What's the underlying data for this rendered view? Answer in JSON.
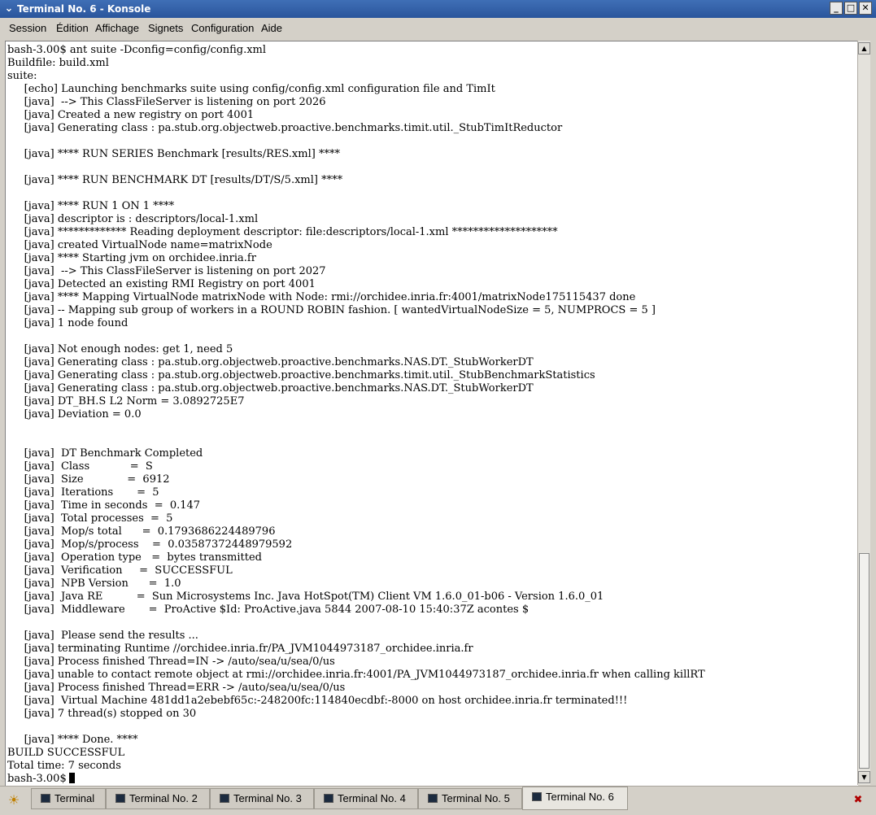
{
  "window": {
    "title": "Terminal No. 6 - Konsole",
    "menu_glyph": "⌄",
    "minimize_glyph": "_",
    "maximize_glyph": "□",
    "close_glyph": "✕"
  },
  "menu": [
    "Session",
    "Édition",
    "Affichage",
    "Signets",
    "Configuration",
    "Aide"
  ],
  "terminal": {
    "lines": [
      "bash-3.00$ ant suite -Dconfig=config/config.xml",
      "Buildfile: build.xml",
      "suite:",
      "     [echo] Launching benchmarks suite using config/config.xml configuration file and TimIt",
      "     [java]  --> This ClassFileServer is listening on port 2026",
      "     [java] Created a new registry on port 4001",
      "     [java] Generating class : pa.stub.org.objectweb.proactive.benchmarks.timit.util._StubTimItReductor",
      "",
      "     [java] **** RUN SERIES Benchmark [results/RES.xml] ****",
      "",
      "     [java] **** RUN BENCHMARK DT [results/DT/S/5.xml] ****",
      "",
      "     [java] **** RUN 1 ON 1 ****",
      "     [java] descriptor is : descriptors/local-1.xml",
      "     [java] ************* Reading deployment descriptor: file:descriptors/local-1.xml ********************",
      "     [java] created VirtualNode name=matrixNode",
      "     [java] **** Starting jvm on orchidee.inria.fr",
      "     [java]  --> This ClassFileServer is listening on port 2027",
      "     [java] Detected an existing RMI Registry on port 4001",
      "     [java] **** Mapping VirtualNode matrixNode with Node: rmi://orchidee.inria.fr:4001/matrixNode175115437 done",
      "     [java] -- Mapping sub group of workers in a ROUND ROBIN fashion. [ wantedVirtualNodeSize = 5, NUMPROCS = 5 ]",
      "     [java] 1 node found",
      "",
      "     [java] Not enough nodes: get 1, need 5",
      "     [java] Generating class : pa.stub.org.objectweb.proactive.benchmarks.NAS.DT._StubWorkerDT",
      "     [java] Generating class : pa.stub.org.objectweb.proactive.benchmarks.timit.util._StubBenchmarkStatistics",
      "     [java] Generating class : pa.stub.org.objectweb.proactive.benchmarks.NAS.DT._StubWorkerDT",
      "     [java] DT_BH.S L2 Norm = 3.0892725E7",
      "     [java] Deviation = 0.0",
      "",
      "",
      "     [java]  DT Benchmark Completed",
      "     [java]  Class            =  S",
      "     [java]  Size             =  6912",
      "     [java]  Iterations       =  5",
      "     [java]  Time in seconds  =  0.147",
      "     [java]  Total processes  =  5",
      "     [java]  Mop/s total      =  0.1793686224489796",
      "     [java]  Mop/s/process    =  0.03587372448979592",
      "     [java]  Operation type   =  bytes transmitted",
      "     [java]  Verification     =  SUCCESSFUL",
      "     [java]  NPB Version      =  1.0",
      "     [java]  Java RE          =  Sun Microsystems Inc. Java HotSpot(TM) Client VM 1.6.0_01-b06 - Version 1.6.0_01",
      "     [java]  Middleware       =  ProActive $Id: ProActive.java 5844 2007-08-10 15:40:37Z acontes $",
      "",
      "     [java]  Please send the results ...",
      "     [java] terminating Runtime //orchidee.inria.fr/PA_JVM1044973187_orchidee.inria.fr",
      "     [java] Process finished Thread=IN -> /auto/sea/u/sea/0/us",
      "     [java] unable to contact remote object at rmi://orchidee.inria.fr:4001/PA_JVM1044973187_orchidee.inria.fr when calling killRT",
      "     [java] Process finished Thread=ERR -> /auto/sea/u/sea/0/us",
      "     [java]  Virtual Machine 481dd1a2ebebf65c:-248200fc:114840ecdbf:-8000 on host orchidee.inria.fr terminated!!!",
      "     [java] 7 thread(s) stopped on 30",
      "",
      "     [java] **** Done. ****",
      "BUILD SUCCESSFUL",
      "Total time: 7 seconds"
    ],
    "prompt": "bash-3.00$"
  },
  "scrollbar": {
    "up_glyph": "▲",
    "down_glyph": "▼"
  },
  "tabs": [
    "Terminal",
    "Terminal No. 2",
    "Terminal No. 3",
    "Terminal No. 4",
    "Terminal No. 5",
    "Terminal No. 6"
  ],
  "active_tab": "Terminal No. 6",
  "icons": {
    "new_session": "new-session-icon",
    "close_session": "close-session-icon",
    "tab": "terminal-tab-icon"
  },
  "colors": {
    "titlebar": "#2a559c",
    "terminal_bg": "#ffffff",
    "terminal_fg": "#000000"
  }
}
